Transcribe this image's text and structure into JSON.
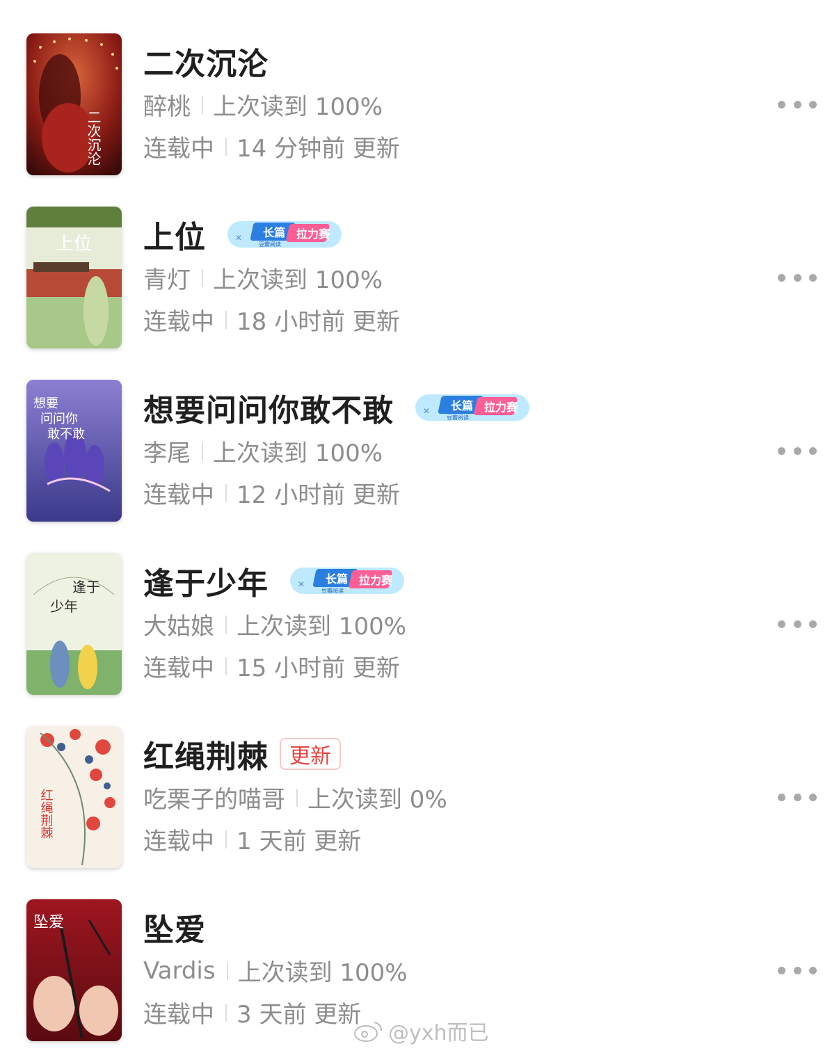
{
  "books": [
    {
      "title": "二次沉沦",
      "author": "醉桃",
      "progress": "上次读到 100%",
      "status": "连载中",
      "updated": "14 分钟前 更新",
      "badge": null,
      "cover_text": "二次沉沦"
    },
    {
      "title": "上位",
      "author": "青灯",
      "progress": "上次读到 100%",
      "status": "连载中",
      "updated": "18 小时前 更新",
      "badge": "contest",
      "cover_text": "上位"
    },
    {
      "title": "想要问问你敢不敢",
      "author": "李尾",
      "progress": "上次读到 100%",
      "status": "连载中",
      "updated": "12 小时前 更新",
      "badge": "contest",
      "cover_text": "想要问问你敢不敢"
    },
    {
      "title": "逢于少年",
      "author": "大姑娘",
      "progress": "上次读到 100%",
      "status": "连载中",
      "updated": "15 小时前 更新",
      "badge": "contest",
      "cover_text": "逢于少年"
    },
    {
      "title": "红绳荆棘",
      "author": "吃栗子的喵哥",
      "progress": "上次读到 0%",
      "status": "连载中",
      "updated": "1 天前 更新",
      "badge": "update",
      "update_label": "更新",
      "cover_text": "红绳荆棘"
    },
    {
      "title": "坠爱",
      "author": "Vardis",
      "progress": "上次读到 100%",
      "status": "连载中",
      "updated": "3 天前 更新",
      "badge": null,
      "cover_text": "坠爱"
    }
  ],
  "contest_badge": {
    "line1": "长篇",
    "line2": "豆瓣阅读",
    "line3": "拉力赛"
  },
  "watermark": "@yxh而已",
  "colors": {
    "title": "#1f1f1f",
    "meta": "#8d8d8d",
    "update_badge": "#e2463f",
    "badge_blue": "#2b7fe0",
    "badge_pink": "#ff5d95"
  }
}
